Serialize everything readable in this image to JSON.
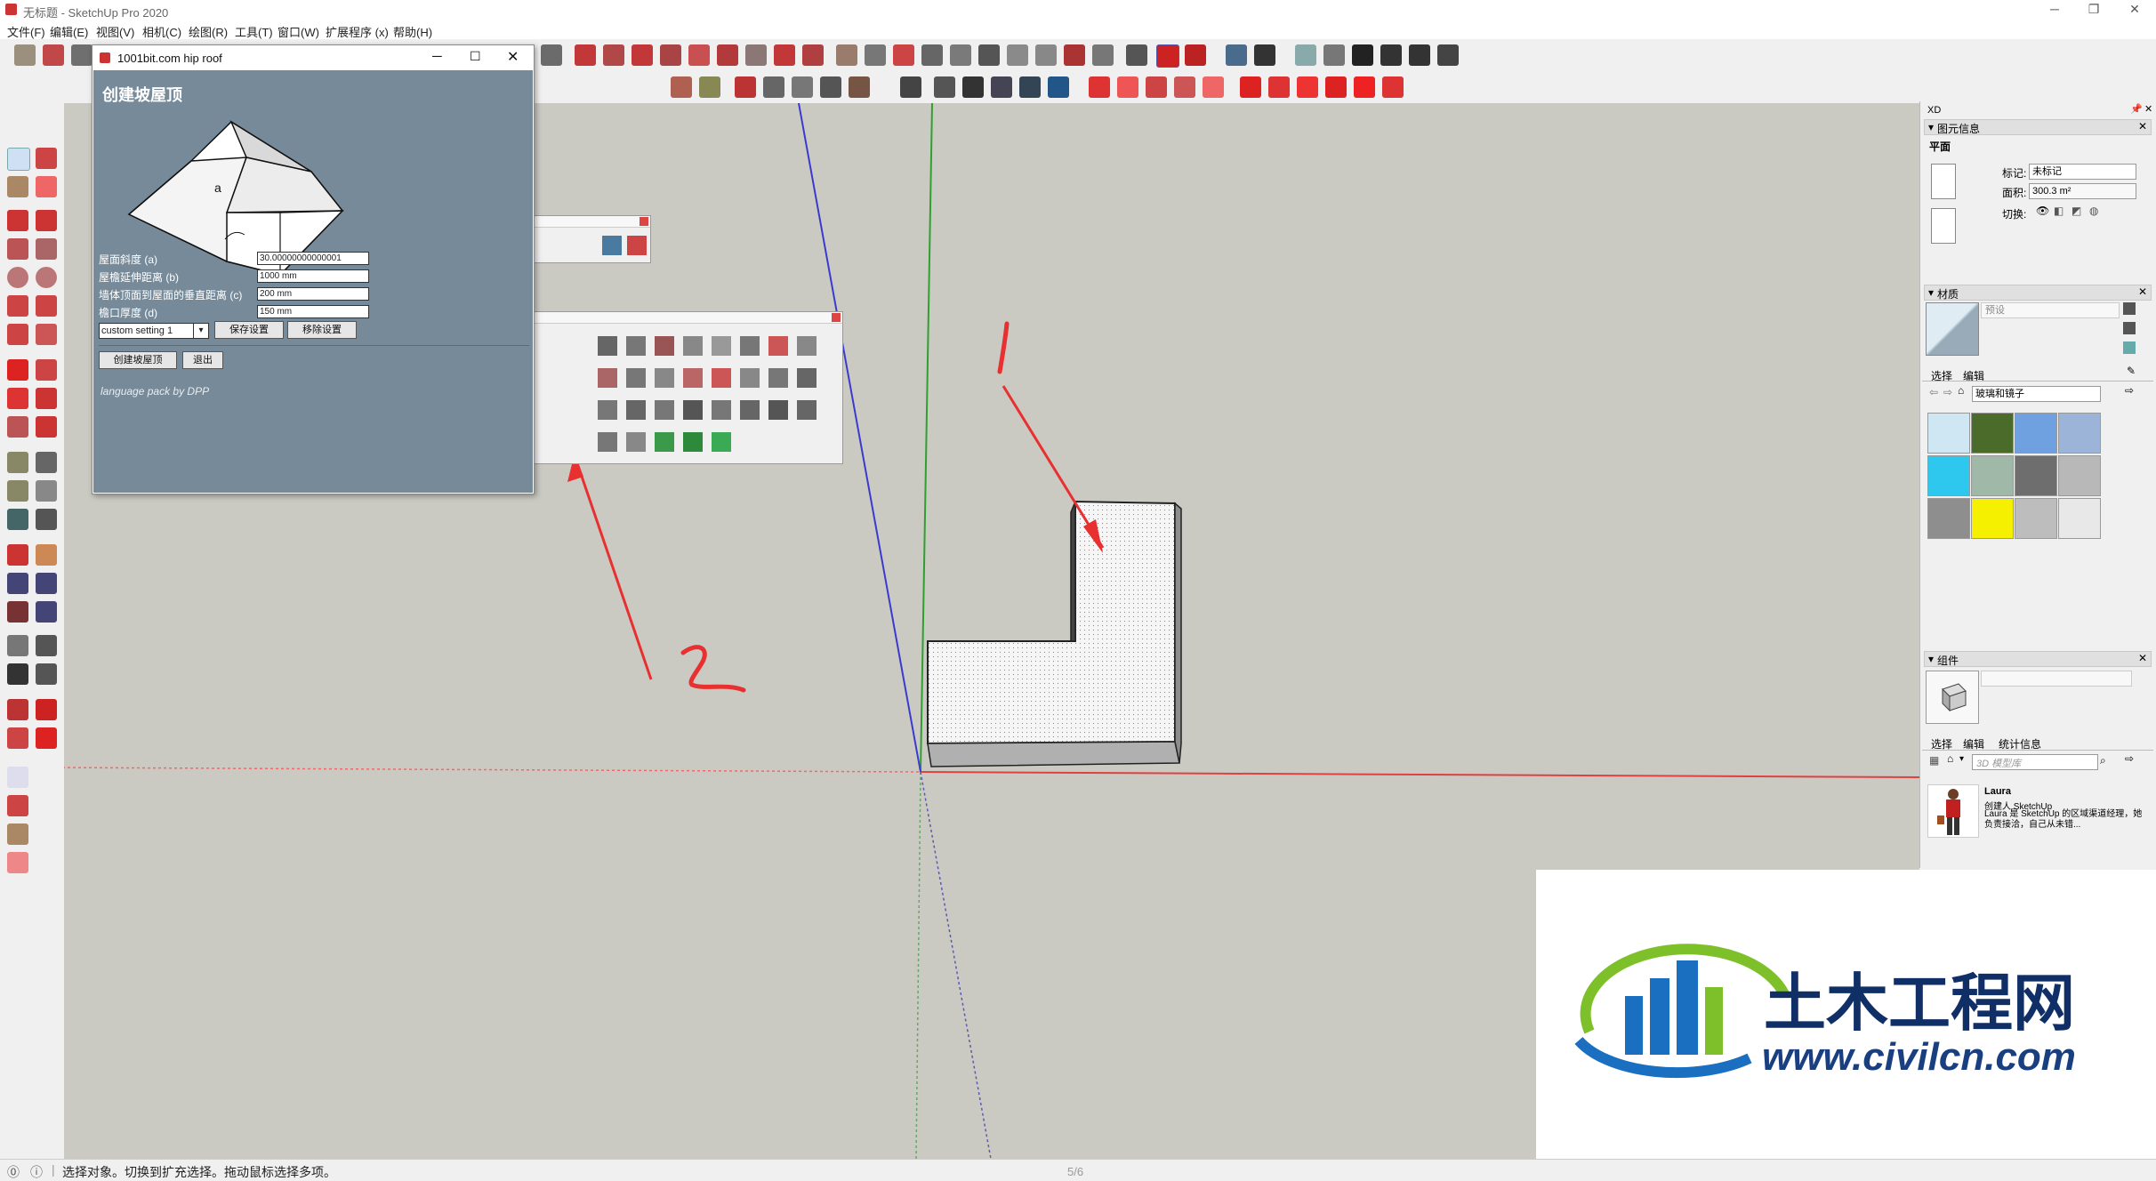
{
  "window": {
    "title": "无标题 - SketchUp Pro 2020"
  },
  "menu": [
    "文件(F)",
    "编辑(E)",
    "视图(V)",
    "相机(C)",
    "绘图(R)",
    "工具(T)",
    "窗口(W)",
    "扩展程序 (x)",
    "帮助(H)"
  ],
  "roof_dialog": {
    "caption": "1001bit.com hip roof",
    "heading": "创建坡屋顶",
    "diagram_label": "a",
    "fields": [
      {
        "label": "屋面斜度 (a)",
        "value": "30.00000000000001"
      },
      {
        "label": "屋檐延伸距离 (b)",
        "value": "1000 mm"
      },
      {
        "label": "墙体顶面到屋面的垂直距离 (c)",
        "value": "200 mm"
      },
      {
        "label": "檐口厚度 (d)",
        "value": "150 mm"
      }
    ],
    "preset_value": "custom setting 1",
    "save_label": "保存设置",
    "remove_label": "移除设置",
    "create_label": "创建坡屋顶",
    "exit_label": "退出",
    "credit": "language pack by DPP"
  },
  "annotations": {
    "mark1": "1",
    "mark2": "2"
  },
  "status": {
    "text": "选择对象。切换到扩充选择。拖动鼠标选择多项。",
    "page": "5/6"
  },
  "tray": {
    "title": "XD",
    "entity_info": {
      "header": "图元信息",
      "type": "平面",
      "tag_label": "标记:",
      "tag_value": "未标记",
      "area_label": "面积:",
      "area_value": "300.3 m²",
      "toggle_label": "切换:"
    },
    "materials": {
      "header": "材质",
      "preset": "预设",
      "tab_select": "选择",
      "tab_edit": "编辑",
      "library": "玻璃和镜子",
      "swatch_colors": [
        "#cfe6f3",
        "#4a6b2a",
        "#6fa0e0",
        "#9cb4d8",
        "#2ec8ef",
        "#9fb8a8",
        "#6e6e6e",
        "#b8b8b8",
        "#8e8e8e",
        "#f4f000",
        "#bdbdbd",
        "#e8e8e8"
      ]
    },
    "components": {
      "header": "组件",
      "tab_select": "选择",
      "tab_edit": "编辑",
      "tab_stats": "统计信息",
      "search_placeholder": "3D 模型库",
      "item_name": "Laura",
      "item_author": "创建人 SketchUp",
      "item_desc": "Laura 是 SketchUp 的区域渠道经理，她负责接洽，自己从未错..."
    }
  },
  "watermark": {
    "brand": "土木工程网",
    "url": "www.civilcn.com"
  },
  "colors": {
    "viewport": "#cacac3",
    "dialog": "#768a99",
    "red_axis": "#e04040",
    "green_axis": "#2fa02f",
    "blue_axis": "#3a3ad0",
    "annotation": "#e83030",
    "brand_blue": "#1a6fc0",
    "brand_green": "#7ec02a"
  }
}
